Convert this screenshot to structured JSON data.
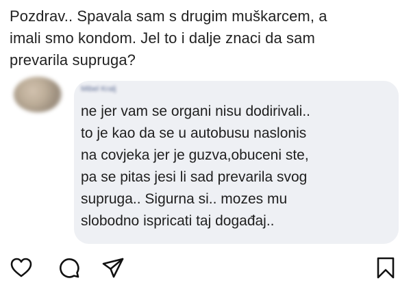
{
  "post": {
    "question_lines": [
      "Pozdrav.. Spavala sam s drugim muškarcem, a",
      "imali smo kondom. Jel to i dalje znaci da sam",
      "prevarila supruga?"
    ]
  },
  "comment": {
    "author_name": "Mibel Kralj",
    "text_lines": [
      "ne jer vam se organi nisu dodirivali..",
      "to je kao da se u autobusu naslonis",
      "na covjeka jer je guzva,obuceni ste,",
      "pa se pitas jesi li sad prevarila svog",
      "supruga.. Sigurna si.. mozes mu",
      "slobodno ispricati taj događaj.."
    ]
  },
  "actions": {
    "icons": [
      "heart-icon",
      "comment-icon",
      "share-icon",
      "bookmark-icon"
    ]
  },
  "colors": {
    "comment_background": "#eef0f4",
    "text": "#1e1e1e",
    "icon_stroke": "#111111"
  }
}
